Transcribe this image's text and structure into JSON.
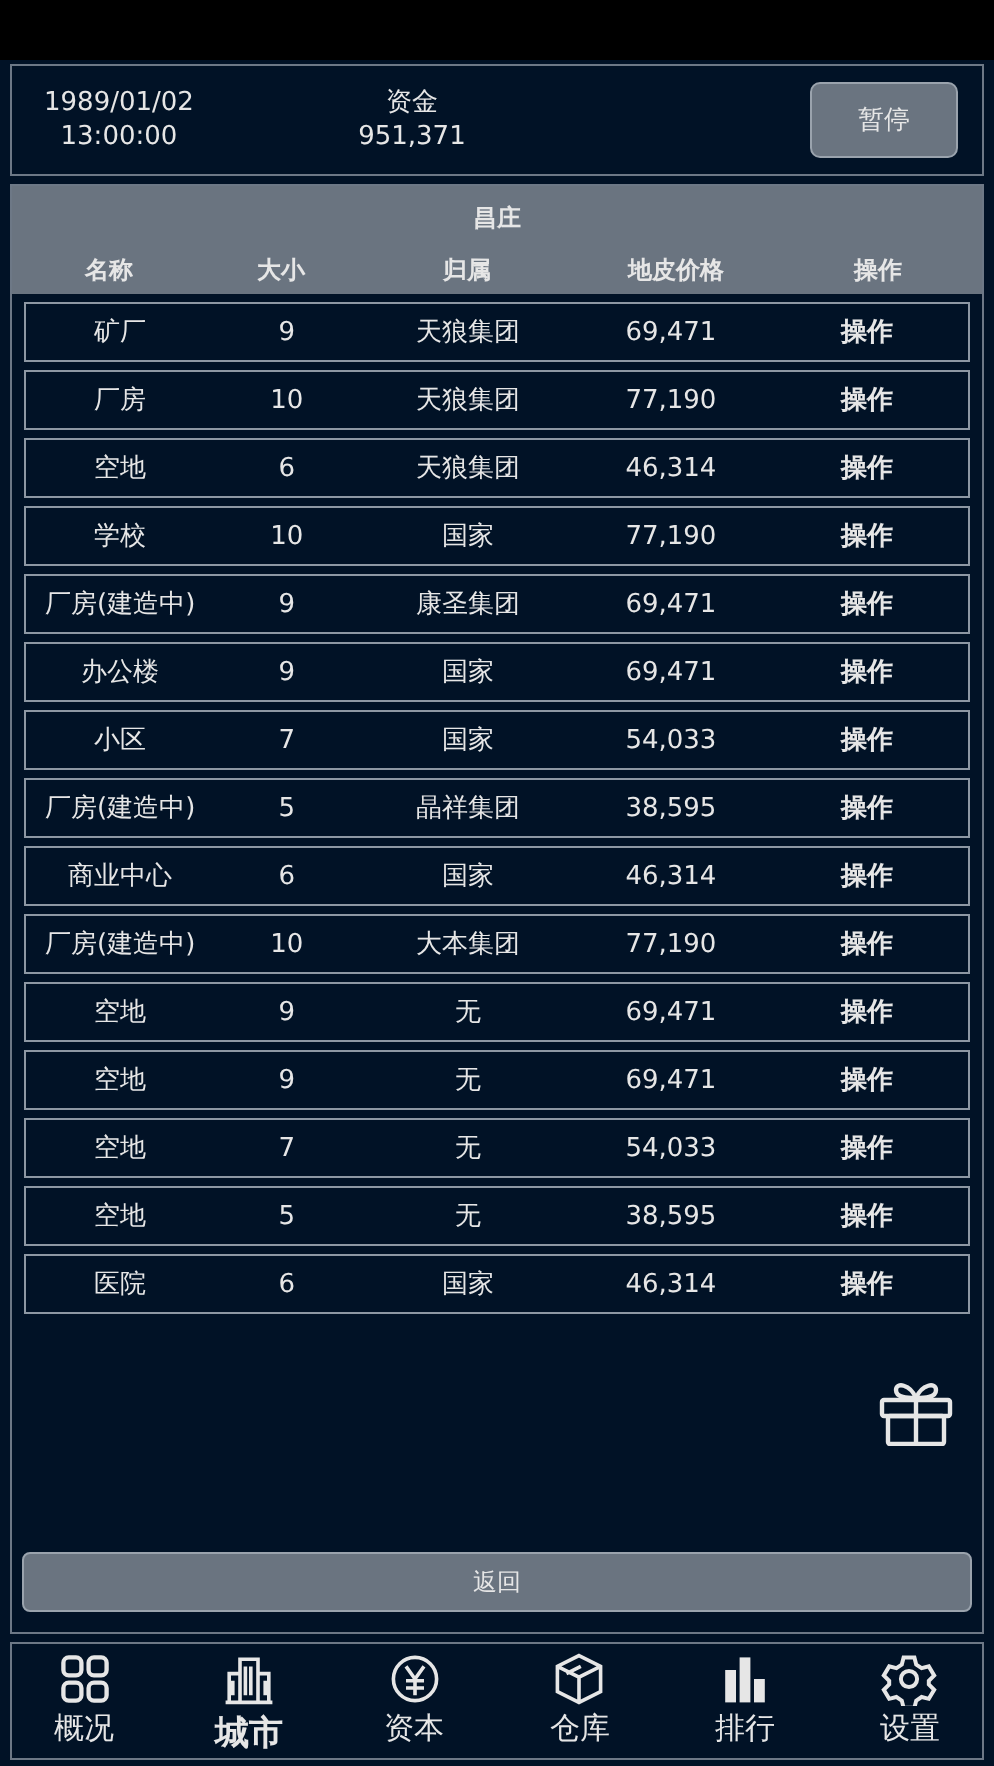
{
  "status": {
    "date": "1989/01/02",
    "time": "13:00:00",
    "funds_label": "资金",
    "funds": "951,371",
    "pause_button": "暂停"
  },
  "table": {
    "title": "昌庄",
    "columns": [
      "名称",
      "大小",
      "归属",
      "地皮价格",
      "操作"
    ],
    "rows": [
      {
        "name": "矿厂",
        "size": "9",
        "owner": "天狼集团",
        "price": "69,471",
        "action": "操作"
      },
      {
        "name": "厂房",
        "size": "10",
        "owner": "天狼集团",
        "price": "77,190",
        "action": "操作"
      },
      {
        "name": "空地",
        "size": "6",
        "owner": "天狼集团",
        "price": "46,314",
        "action": "操作"
      },
      {
        "name": "学校",
        "size": "10",
        "owner": "国家",
        "price": "77,190",
        "action": "操作"
      },
      {
        "name": "厂房(建造中)",
        "size": "9",
        "owner": "康圣集团",
        "price": "69,471",
        "action": "操作"
      },
      {
        "name": "办公楼",
        "size": "9",
        "owner": "国家",
        "price": "69,471",
        "action": "操作"
      },
      {
        "name": "小区",
        "size": "7",
        "owner": "国家",
        "price": "54,033",
        "action": "操作"
      },
      {
        "name": "厂房(建造中)",
        "size": "5",
        "owner": "晶祥集团",
        "price": "38,595",
        "action": "操作"
      },
      {
        "name": "商业中心",
        "size": "6",
        "owner": "国家",
        "price": "46,314",
        "action": "操作"
      },
      {
        "name": "厂房(建造中)",
        "size": "10",
        "owner": "大本集团",
        "price": "77,190",
        "action": "操作"
      },
      {
        "name": "空地",
        "size": "9",
        "owner": "无",
        "price": "69,471",
        "action": "操作"
      },
      {
        "name": "空地",
        "size": "9",
        "owner": "无",
        "price": "69,471",
        "action": "操作"
      },
      {
        "name": "空地",
        "size": "7",
        "owner": "无",
        "price": "54,033",
        "action": "操作"
      },
      {
        "name": "空地",
        "size": "5",
        "owner": "无",
        "price": "38,595",
        "action": "操作"
      },
      {
        "name": "医院",
        "size": "6",
        "owner": "国家",
        "price": "46,314",
        "action": "操作"
      }
    ]
  },
  "back_button": "返回",
  "nav": [
    {
      "label": "概况",
      "selected": false
    },
    {
      "label": "城市",
      "selected": true
    },
    {
      "label": "资本",
      "selected": false
    },
    {
      "label": "仓库",
      "selected": false
    },
    {
      "label": "排行",
      "selected": false
    },
    {
      "label": "设置",
      "selected": false
    }
  ]
}
